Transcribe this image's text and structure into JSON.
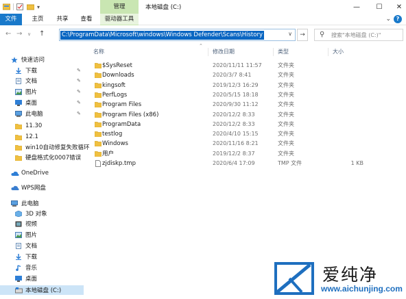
{
  "window": {
    "context_tab": "管理",
    "title": "本地磁盘 (C:)",
    "controls": {
      "minimize": "—",
      "maximize": "☐",
      "close": "✕"
    }
  },
  "ribbon": {
    "tabs": [
      "文件",
      "主页",
      "共享",
      "查看",
      "驱动器工具"
    ],
    "accent": "#1979ca",
    "context_color": "#c9e6b2"
  },
  "address": {
    "path": "C:\\ProgramData\\Microsoft\\windows\\Windows Defender\\Scans\\History",
    "search_placeholder": "搜索\"本地磁盘 (C:)\""
  },
  "sidebar": {
    "items": [
      {
        "label": "快速访问",
        "icon": "star-icon",
        "pinned": false
      },
      {
        "label": "下载",
        "icon": "download-icon",
        "pinned": true
      },
      {
        "label": "文档",
        "icon": "document-icon",
        "pinned": true
      },
      {
        "label": "图片",
        "icon": "picture-icon",
        "pinned": true
      },
      {
        "label": "桌面",
        "icon": "desktop-icon",
        "pinned": true
      },
      {
        "label": "此电脑",
        "icon": "computer-icon",
        "pinned": true
      },
      {
        "label": "11.30",
        "icon": "folder-icon",
        "pinned": false
      },
      {
        "label": "12.1",
        "icon": "folder-icon",
        "pinned": false
      },
      {
        "label": "win10自动修复失败循环",
        "icon": "folder-icon",
        "pinned": false
      },
      {
        "label": "硬盘格式化0007错误",
        "icon": "folder-icon",
        "pinned": false
      },
      {
        "label": "OneDrive",
        "icon": "cloud-icon",
        "pinned": false
      },
      {
        "label": "WPS网盘",
        "icon": "wps-cloud-icon",
        "pinned": false
      },
      {
        "label": "此电脑",
        "icon": "computer-icon",
        "pinned": false
      },
      {
        "label": "3D 对象",
        "icon": "cube-icon",
        "pinned": false
      },
      {
        "label": "视频",
        "icon": "video-icon",
        "pinned": false
      },
      {
        "label": "图片",
        "icon": "picture-icon",
        "pinned": false
      },
      {
        "label": "文档",
        "icon": "document-icon",
        "pinned": false
      },
      {
        "label": "下载",
        "icon": "download-icon",
        "pinned": false
      },
      {
        "label": "音乐",
        "icon": "music-icon",
        "pinned": false
      },
      {
        "label": "桌面",
        "icon": "desktop-icon",
        "pinned": false
      },
      {
        "label": "本地磁盘 (C:)",
        "icon": "drive-icon",
        "pinned": false,
        "selected": true
      }
    ]
  },
  "columns": [
    "名称",
    "修改日期",
    "类型",
    "大小"
  ],
  "files": [
    {
      "name": "$SysReset",
      "date": "2020/11/11 11:57",
      "type": "文件夹",
      "size": ""
    },
    {
      "name": "Downloads",
      "date": "2020/3/7 8:41",
      "type": "文件夹",
      "size": ""
    },
    {
      "name": "kingsoft",
      "date": "2019/12/3 16:29",
      "type": "文件夹",
      "size": ""
    },
    {
      "name": "PerfLogs",
      "date": "2020/5/15 18:18",
      "type": "文件夹",
      "size": ""
    },
    {
      "name": "Program Files",
      "date": "2020/9/30 11:12",
      "type": "文件夹",
      "size": ""
    },
    {
      "name": "Program Files (x86)",
      "date": "2020/12/2 8:33",
      "type": "文件夹",
      "size": ""
    },
    {
      "name": "ProgramData",
      "date": "2020/12/2 8:33",
      "type": "文件夹",
      "size": ""
    },
    {
      "name": "testlog",
      "date": "2020/4/10 15:15",
      "type": "文件夹",
      "size": ""
    },
    {
      "name": "Windows",
      "date": "2020/11/16 8:21",
      "type": "文件夹",
      "size": ""
    },
    {
      "name": "用户",
      "date": "2019/12/2 8:37",
      "type": "文件夹",
      "size": ""
    },
    {
      "name": "zjdiskp.tmp",
      "date": "2020/6/4 17:09",
      "type": "TMP 文件",
      "size": "1 KB"
    }
  ],
  "watermark": {
    "brand": "爱纯净",
    "url": "www.aichunjing.com"
  }
}
